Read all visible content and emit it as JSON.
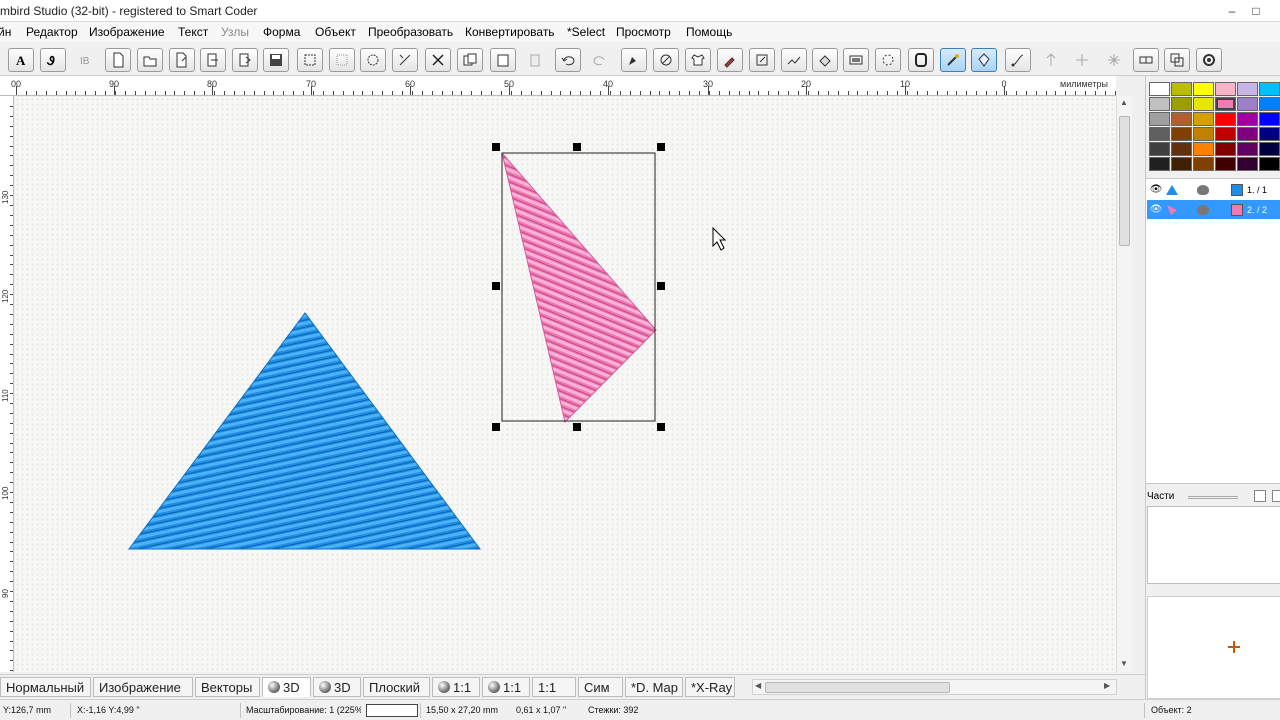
{
  "window": {
    "title": "mbird Studio (32-bit)  - registered to Smart Coder"
  },
  "menu": [
    "йн",
    "Редактор",
    "Изображение",
    "Текст",
    "Узлы",
    "Форма",
    "Объект",
    "Преобразовать",
    "Конвертировать",
    "*Select",
    "Просмотр",
    "Помощь"
  ],
  "menu_disabled_index": 4,
  "toolbar_icons": [
    "text-tool-icon",
    "text-path-icon",
    "text-mono-icon",
    "new-file-icon",
    "open-file-icon",
    "save-as-icon",
    "import-icon",
    "export-icon",
    "save-icon",
    "select-frame-icon",
    "select-rect-icon",
    "node-icon",
    "transform-icon",
    "delete-icon",
    "copy-icon",
    "paste-icon",
    "clipboard-icon",
    "undo-icon",
    "redo-icon",
    "pen-tool-icon",
    "eraser-icon",
    "shirt-icon",
    "eyedropper-icon",
    "resize-icon",
    "stitch-icon",
    "fill-icon",
    "frame-icon",
    "scan-icon",
    "hoop-icon",
    "wand-icon",
    "color-tool-icon",
    "line-tool-icon",
    "move-up-icon",
    "center-icon",
    "star-icon",
    "split-icon",
    "group-icon",
    "settings-icon"
  ],
  "ruler": {
    "unit": "милиметры",
    "top_labels": [
      "00",
      "90",
      "80",
      "70",
      "60",
      "50",
      "40",
      "30",
      "20",
      "10",
      "0"
    ],
    "left_labels": [
      "130",
      "120",
      "110",
      "100",
      "90"
    ]
  },
  "canvas": {
    "objects": [
      {
        "name": "blue-triangle",
        "color": "#1e8ee8"
      },
      {
        "name": "pink-triangle",
        "color": "#f07ab4",
        "selected": true
      }
    ]
  },
  "view_tabs": [
    {
      "label": "Нормальный"
    },
    {
      "label": "Изображение"
    },
    {
      "label": "Векторы"
    },
    {
      "label": "3D",
      "dot": true,
      "active": true
    },
    {
      "label": "3D",
      "dot": true
    },
    {
      "label": "Плоский"
    },
    {
      "label": "1:1",
      "dot": true
    },
    {
      "label": "1:1",
      "dot": true
    },
    {
      "label": "1:1"
    },
    {
      "label": "Сим"
    },
    {
      "label": "*D. Map"
    },
    {
      "label": "*X-Ray"
    }
  ],
  "status": {
    "y": "Y:126,7 mm",
    "xy": "X:-1,16  Y:4,99 \"",
    "scale": "Масштабирование: 1 (225%",
    "size": "15,50 x 27,20 mm",
    "size_in": "0,61 x 1,07 \"",
    "stitches": "Стежки: 392",
    "objects": "Объект: 2"
  },
  "palette": [
    "#ffffff",
    "#bdbd00",
    "#ffff00",
    "#f9b4c8",
    "#c8b4e6",
    "#00bfff",
    "#c0c0c0",
    "#9d9d00",
    "#e6e600",
    "#f07ab4",
    "#9b7fc8",
    "#0080ff",
    "#a0a0a0",
    "#b06030",
    "#d4a000",
    "#ff0000",
    "#a000a0",
    "#0000ff",
    "#606060",
    "#804000",
    "#c08000",
    "#c00000",
    "#800080",
    "#000080",
    "#404040",
    "#603010",
    "#ff8000",
    "#800000",
    "#600060",
    "#000040",
    "#202020",
    "#402000",
    "#804000",
    "#400000",
    "#300030",
    "#000000"
  ],
  "object_list": [
    {
      "label": "1. / 1",
      "color": "#1e8ee8"
    },
    {
      "label": "2. / 2",
      "color": "#f07ab4",
      "selected": true
    }
  ],
  "parts_label": "Части"
}
